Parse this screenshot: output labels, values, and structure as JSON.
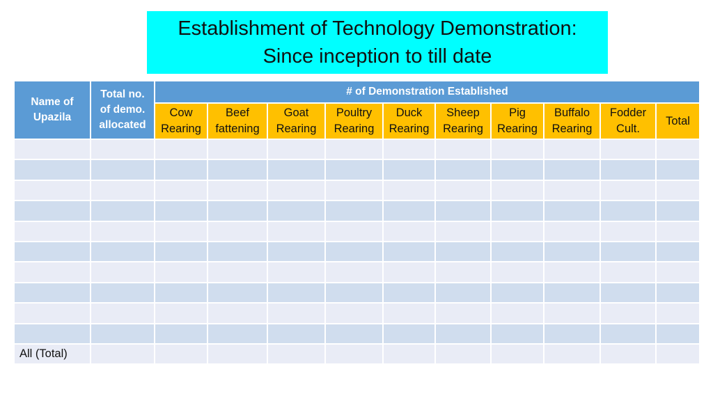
{
  "title": {
    "line1": "Establishment of Technology Demonstration:",
    "line2": "Since inception to till date",
    "background": "#00ffff"
  },
  "table": {
    "header_upazila": "Name of Upazila",
    "header_total_allocated": "Total no. of demo. allocated",
    "header_group": "# of Demonstration Established",
    "columns": [
      {
        "line1": "Cow",
        "line2": "Rearing"
      },
      {
        "line1": "Beef",
        "line2": "fattening"
      },
      {
        "line1": "Goat",
        "line2": "Rearing"
      },
      {
        "line1": "Poultry",
        "line2": "Rearing"
      },
      {
        "line1": "Duck",
        "line2": "Rearing"
      },
      {
        "line1": "Sheep",
        "line2": "Rearing"
      },
      {
        "line1": "Pig",
        "line2": "Rearing"
      },
      {
        "line1": "Buffalo",
        "line2": "Rearing"
      },
      {
        "line1": "Fodder",
        "line2": "Cult."
      },
      {
        "line1": "Total",
        "line2": ""
      }
    ],
    "rows": [
      [
        "",
        "",
        "",
        "",
        "",
        "",
        "",
        "",
        "",
        "",
        "",
        ""
      ],
      [
        "",
        "",
        "",
        "",
        "",
        "",
        "",
        "",
        "",
        "",
        "",
        ""
      ],
      [
        "",
        "",
        "",
        "",
        "",
        "",
        "",
        "",
        "",
        "",
        "",
        ""
      ],
      [
        "",
        "",
        "",
        "",
        "",
        "",
        "",
        "",
        "",
        "",
        "",
        ""
      ],
      [
        "",
        "",
        "",
        "",
        "",
        "",
        "",
        "",
        "",
        "",
        "",
        ""
      ],
      [
        "",
        "",
        "",
        "",
        "",
        "",
        "",
        "",
        "",
        "",
        "",
        ""
      ],
      [
        "",
        "",
        "",
        "",
        "",
        "",
        "",
        "",
        "",
        "",
        "",
        ""
      ],
      [
        "",
        "",
        "",
        "",
        "",
        "",
        "",
        "",
        "",
        "",
        "",
        ""
      ],
      [
        "",
        "",
        "",
        "",
        "",
        "",
        "",
        "",
        "",
        "",
        "",
        ""
      ],
      [
        "",
        "",
        "",
        "",
        "",
        "",
        "",
        "",
        "",
        "",
        "",
        ""
      ]
    ],
    "total_row_label": "All (Total)",
    "colors": {
      "header_blue": "#5b9bd5",
      "header_orange": "#ffc000",
      "row_light": "#e9ecf6",
      "row_dark": "#d0ddee"
    }
  }
}
